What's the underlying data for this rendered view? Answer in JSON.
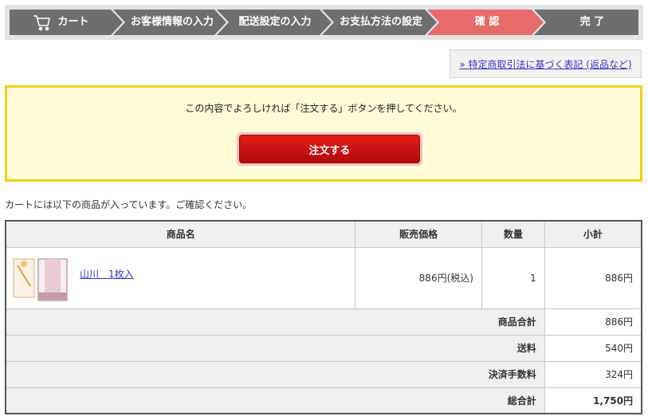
{
  "steps": [
    {
      "label": "カート",
      "icon": "cart-icon",
      "state": "done"
    },
    {
      "label": "お客様情報の入力",
      "state": "done"
    },
    {
      "label": "配送設定の入力",
      "state": "done"
    },
    {
      "label": "お支払方法の設定",
      "state": "done"
    },
    {
      "label": "確 認",
      "state": "current"
    },
    {
      "label": "完 了",
      "state": "todo"
    }
  ],
  "colors": {
    "step_done": "#6e6e6e",
    "step_current": "#e86a6a",
    "confirm_bg": "#fefbd6",
    "confirm_border": "#f1d21b",
    "order_button": "#c91111"
  },
  "legal_link": "» 特定商取引法に基づく表記 (返品など)",
  "confirm": {
    "message": "この内容でよろしければ「注文する」ボタンを押してください。",
    "order_button": "注文する"
  },
  "intro": "カートには以下の商品が入っています。ご確認ください。",
  "table": {
    "headers": {
      "product": "商品名",
      "price": "販売価格",
      "qty": "数量",
      "subtotal": "小計"
    },
    "items": [
      {
        "name": "山川　1枚入",
        "price": "886円(税込)",
        "qty": "1",
        "subtotal": "886円",
        "thumbnail": "product-thumbnail"
      }
    ],
    "summary": [
      {
        "label": "商品合計",
        "value": "886円"
      },
      {
        "label": "送料",
        "value": "540円"
      },
      {
        "label": "決済手数料",
        "value": "324円"
      },
      {
        "label": "総合計",
        "value": "1,750円"
      }
    ]
  }
}
